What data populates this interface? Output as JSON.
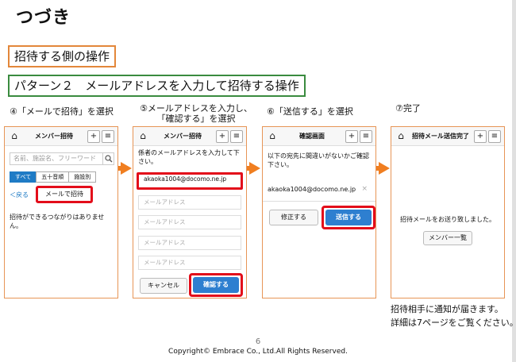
{
  "page": {
    "title": "つづき",
    "heading_orange": "招待する側の操作",
    "heading_green": "パターン２　メールアドレスを入力して招待する操作",
    "page_number": "6",
    "copyright": "Copyright© Embrace Co., Ltd.All Rights Reserved.",
    "note_line1": "招待相手に通知が届きます。",
    "note_line2": "詳細は7ページをご覧ください。"
  },
  "steps": {
    "s4": "④「メールで招待」を選択",
    "s5_line1": "⑤メールアドレスを入力し、",
    "s5_line2": "「確認する」を選択",
    "s6": "⑥「送信する」を選択",
    "s7": "⑦完了"
  },
  "icons": {
    "home": "⌂",
    "add_user": "+",
    "menu": "≡",
    "search": "🔍",
    "back": "＜",
    "close": "×"
  },
  "screen1": {
    "header_title": "メンバー招待",
    "search_placeholder": "名前、施設名、フリーワード",
    "seg_all": "すべて",
    "seg_kana": "五十音順",
    "seg_facility": "施設別",
    "back_label": "戻る",
    "mail_invite": "メールで招待",
    "empty_text": "招待ができるつながりはありません。"
  },
  "screen2": {
    "header_title": "メンバー招待",
    "desc": "係者のメールアドレスを入力して下さい。",
    "email_value": "akaoka1004@docomo.ne.jp",
    "placeholder": "メールアドレス",
    "cancel": "キャンセル",
    "confirm": "確認する"
  },
  "screen3": {
    "header_title": "確認画面",
    "desc": "以下の宛先に間違いがないかご確認下さい。",
    "address": "akaoka1004@docomo.ne.jp",
    "fix": "修正する",
    "send": "送信する"
  },
  "screen4": {
    "header_title": "招待メール送信完了",
    "done_text": "招待メールをお送り致しました。",
    "member_list": "メンバー一覧"
  },
  "colors": {
    "accent_orange": "#f07e20",
    "highlight_red": "#e30d1a",
    "primary_blue": "#2e7fd0",
    "heading_green": "#3a8b3f"
  }
}
